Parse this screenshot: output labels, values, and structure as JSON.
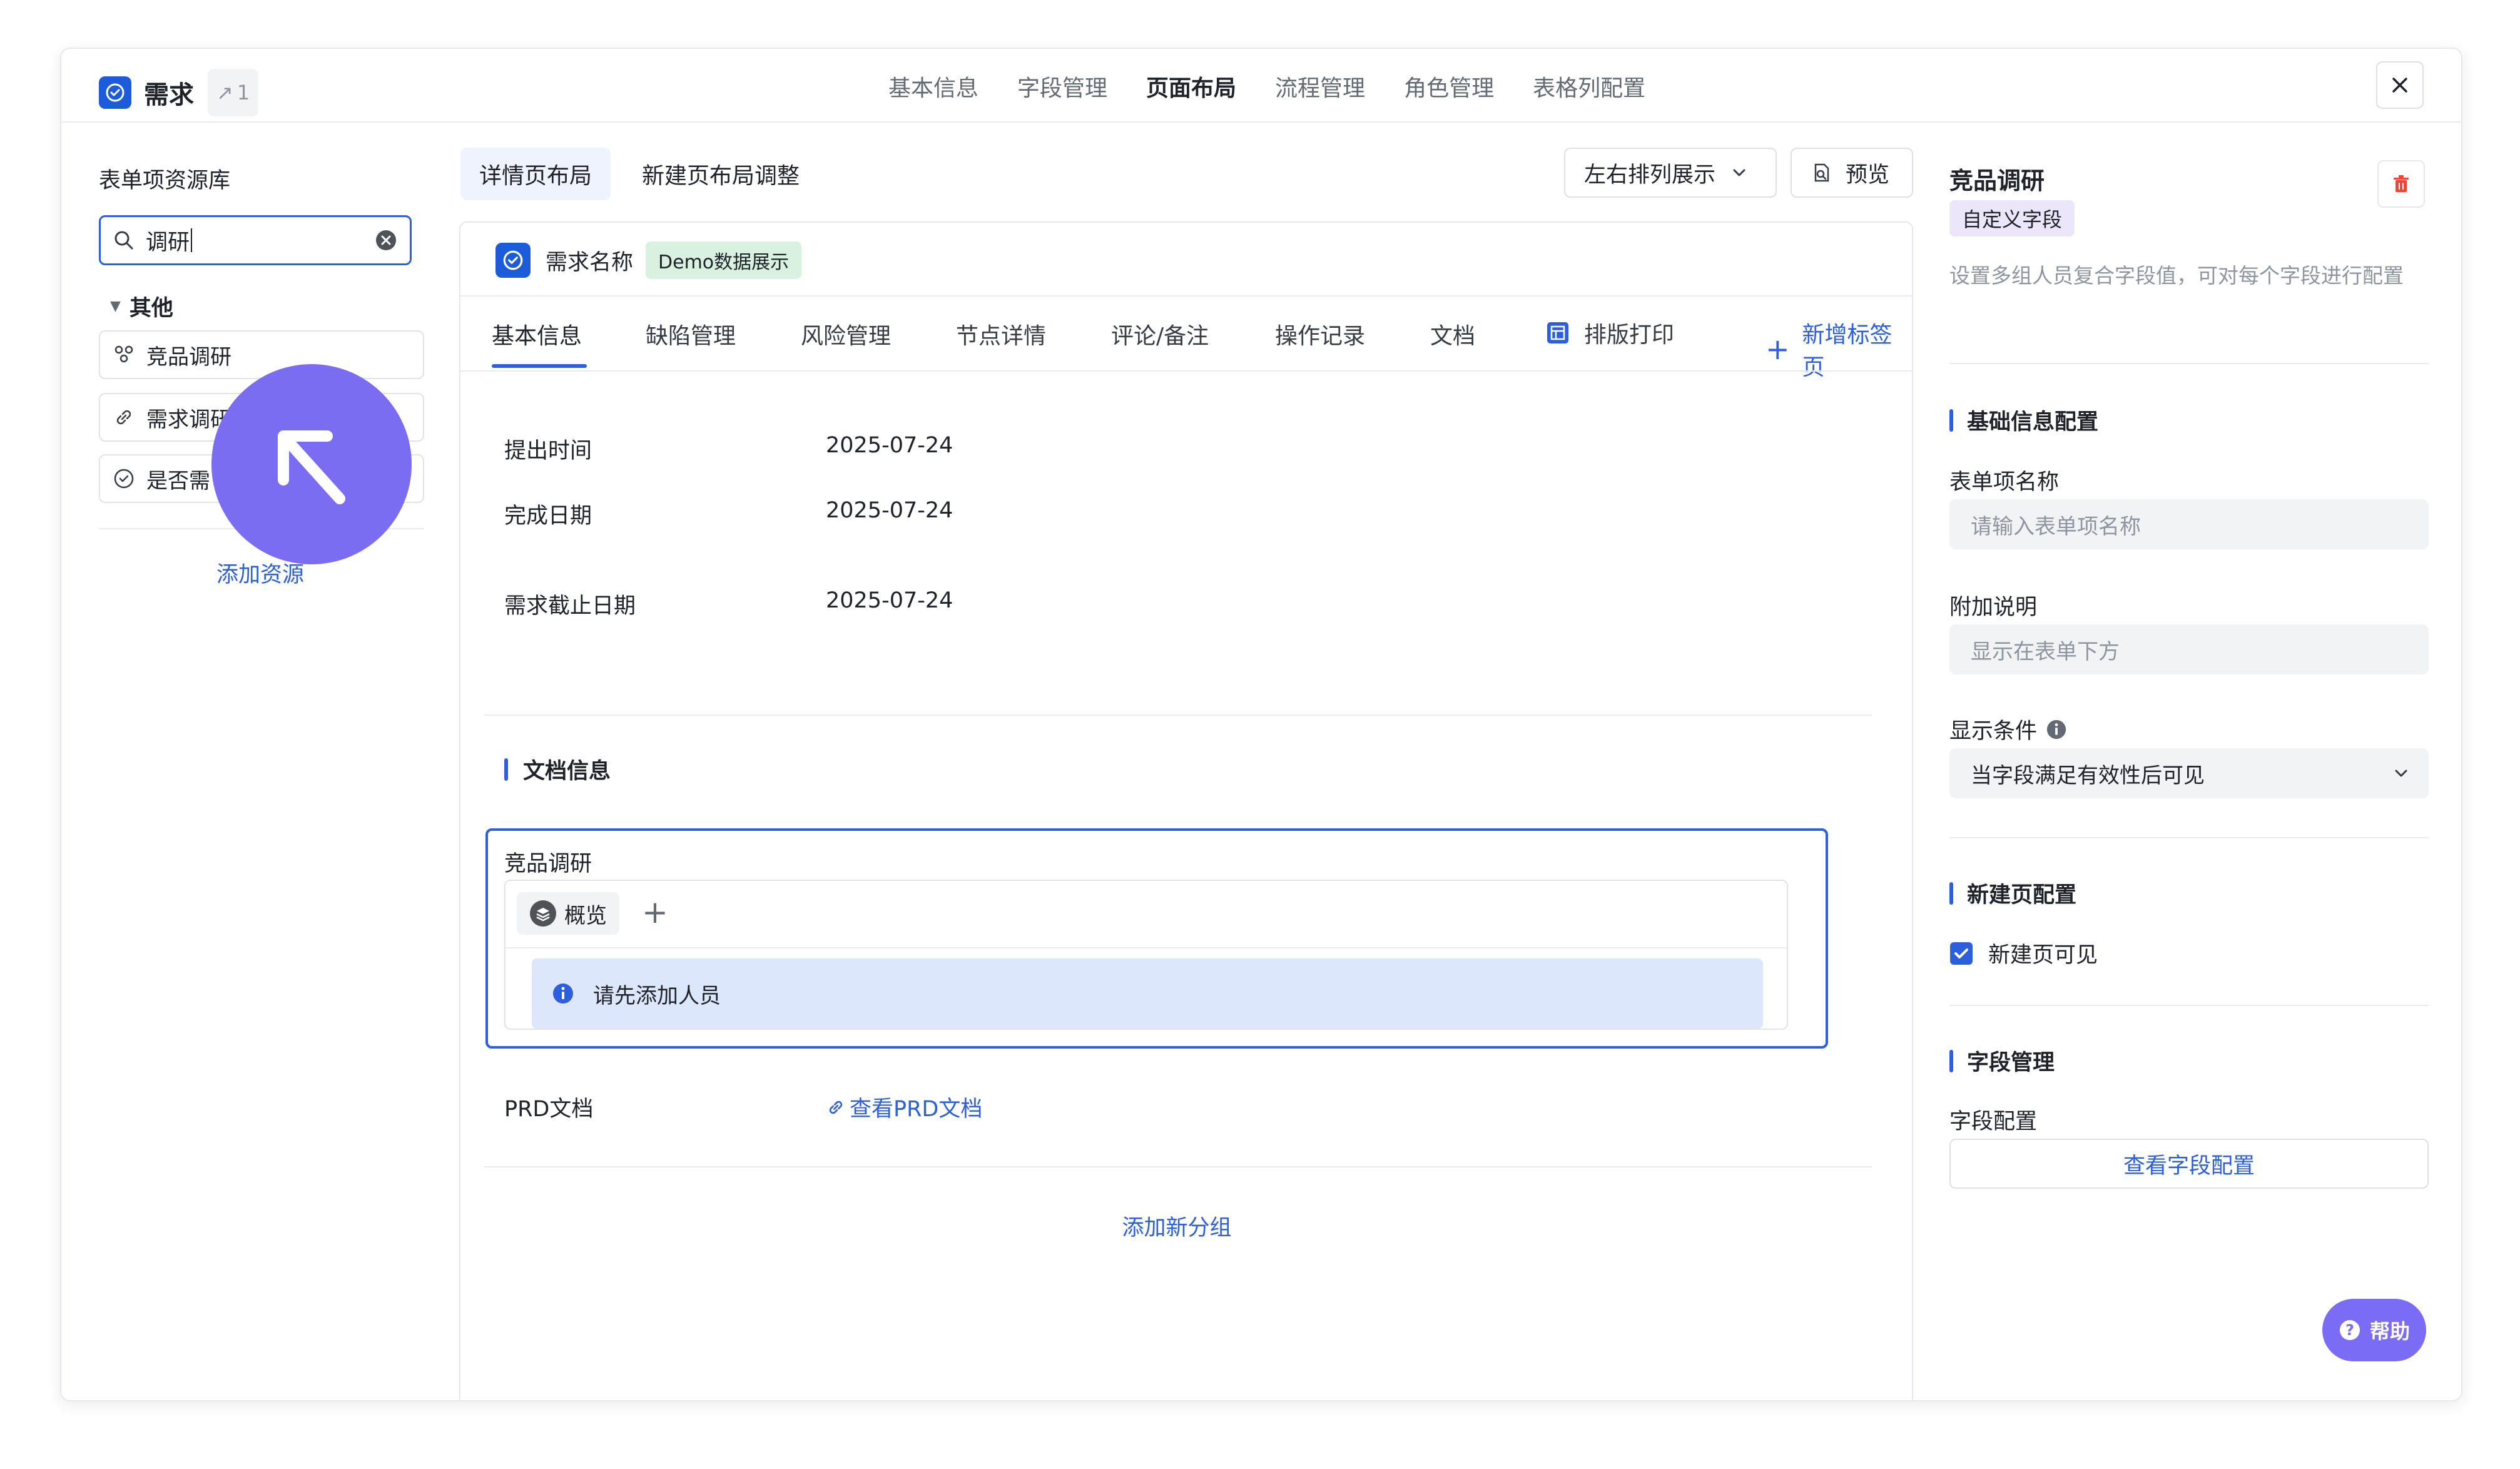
{
  "header": {
    "title": "需求",
    "badge_count": "1",
    "tabs": [
      "基本信息",
      "字段管理",
      "页面布局",
      "流程管理",
      "角色管理",
      "表格列配置"
    ],
    "active_tab": "页面布局"
  },
  "library": {
    "title": "表单项资源库",
    "search_value": "调研",
    "group_label": "其他",
    "items": [
      {
        "label": "竞品调研",
        "icon": "people-group-icon"
      },
      {
        "label": "需求调研",
        "icon": "link-icon"
      },
      {
        "label": "是否需",
        "icon": "check-circle-icon"
      }
    ],
    "add_label": "添加资源"
  },
  "layout_tabs": {
    "active": "详情页布局",
    "other": "新建页布局调整",
    "arrange_label": "左右排列展示",
    "preview_label": "预览"
  },
  "detail": {
    "record_title": "需求名称",
    "demo_badge": "Demo数据展示",
    "tabs": [
      "基本信息",
      "缺陷管理",
      "风险管理",
      "节点详情",
      "评论/备注",
      "操作记录",
      "文档",
      "排版打印"
    ],
    "add_tab_label": "新增标签页",
    "fields": [
      {
        "label": "提出时间",
        "value": "2025-07-24"
      },
      {
        "label": "完成日期",
        "value": "2025-07-24"
      },
      {
        "label": "需求截止日期",
        "value": "2025-07-24"
      }
    ],
    "group_title": "文档信息",
    "card": {
      "title": "竞品调研",
      "chip_label": "概览",
      "notice": "请先添加人员"
    },
    "prd_label": "PRD文档",
    "prd_link": "查看PRD文档",
    "add_group": "添加新分组"
  },
  "right_panel": {
    "title": "竞品调研",
    "tag": "自定义字段",
    "description": "设置多组人员复合字段值，可对每个字段进行配置",
    "basic_section": "基础信息配置",
    "name_label": "表单项名称",
    "name_placeholder": "请输入表单项名称",
    "note_label": "附加说明",
    "note_placeholder": "显示在表单下方",
    "condition_label": "显示条件",
    "condition_value": "当字段满足有效性后可见",
    "newpage_section": "新建页配置",
    "newpage_visible": "新建页可见",
    "field_section": "字段管理",
    "field_config_label": "字段配置",
    "field_config_button": "查看字段配置"
  },
  "help_label": "帮助",
  "colors": {
    "accent": "#2d5fdc",
    "bubble": "#7a6df2",
    "danger": "#f04438",
    "demo_badge_bg": "#d9f2df"
  }
}
